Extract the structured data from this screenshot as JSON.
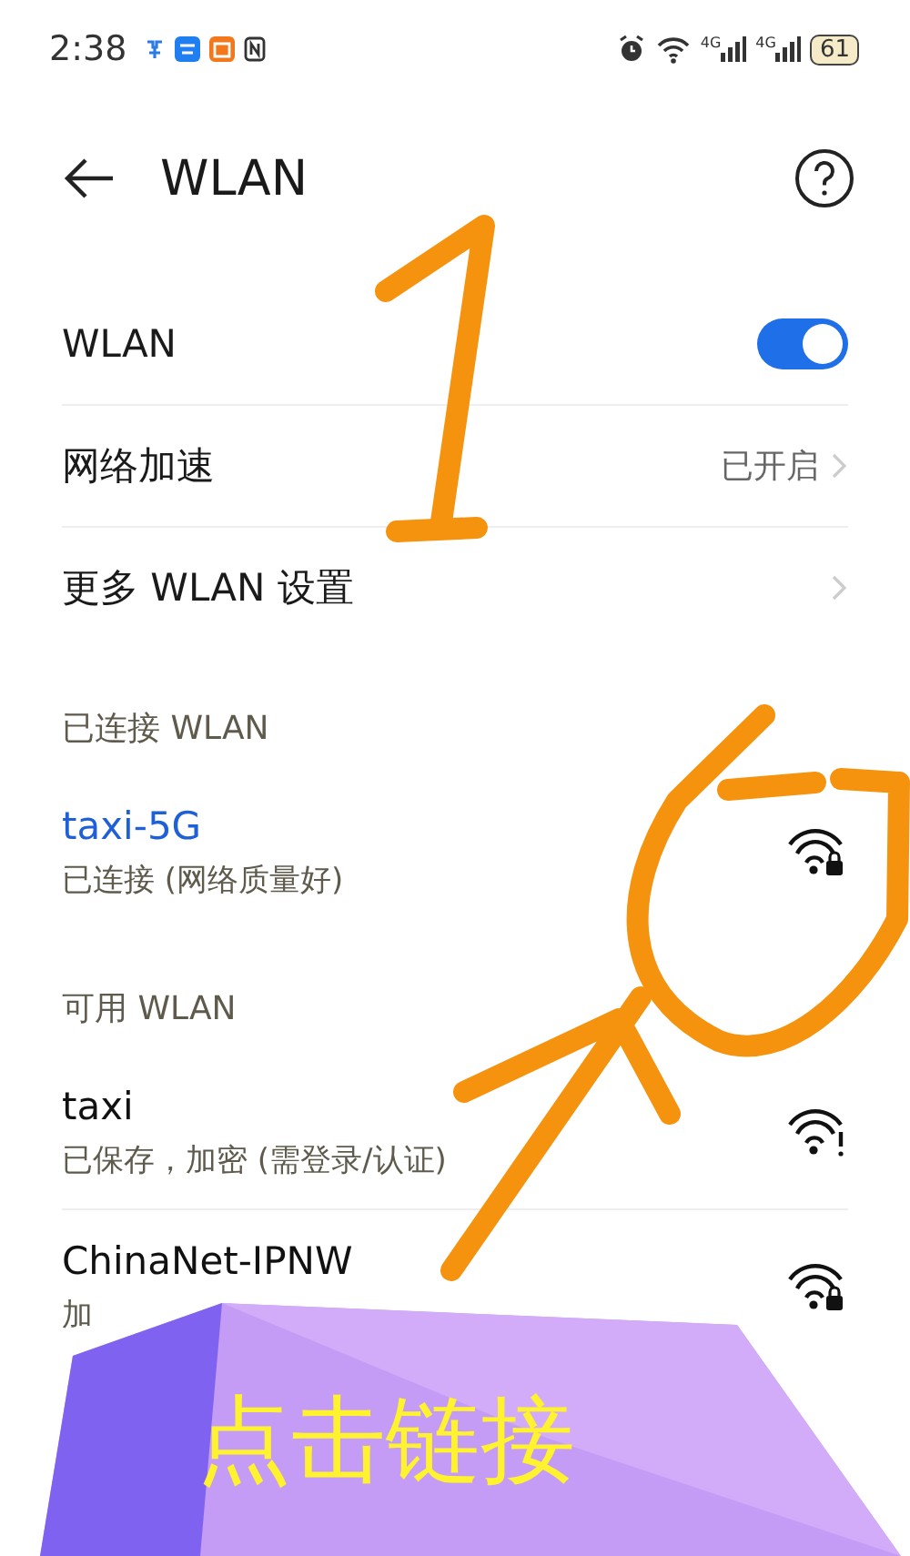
{
  "status_bar": {
    "time": "2:38",
    "signals": [
      "4G",
      "4G"
    ],
    "battery": "61"
  },
  "header": {
    "title": "WLAN"
  },
  "settings": [
    {
      "kind": "toggle",
      "label": "WLAN",
      "on": true
    },
    {
      "kind": "link",
      "label": "网络加速",
      "value": "已开启"
    },
    {
      "kind": "link",
      "label": "更多 WLAN 设置"
    }
  ],
  "connected": {
    "title": "已连接 WLAN",
    "networks": [
      {
        "name": "taxi-5G",
        "status": "已连接 (网络质量好)",
        "connected": true,
        "kind": "lock"
      }
    ]
  },
  "available": {
    "title": "可用 WLAN",
    "networks": [
      {
        "name": "taxi",
        "status": "已保存，加密 (需登录/认证)",
        "connected": false,
        "kind": "alert"
      },
      {
        "name": "ChinaNet-IPNW",
        "status": "加",
        "connected": false,
        "kind": "lock"
      }
    ]
  },
  "overlay": {
    "text": "点击链接"
  }
}
